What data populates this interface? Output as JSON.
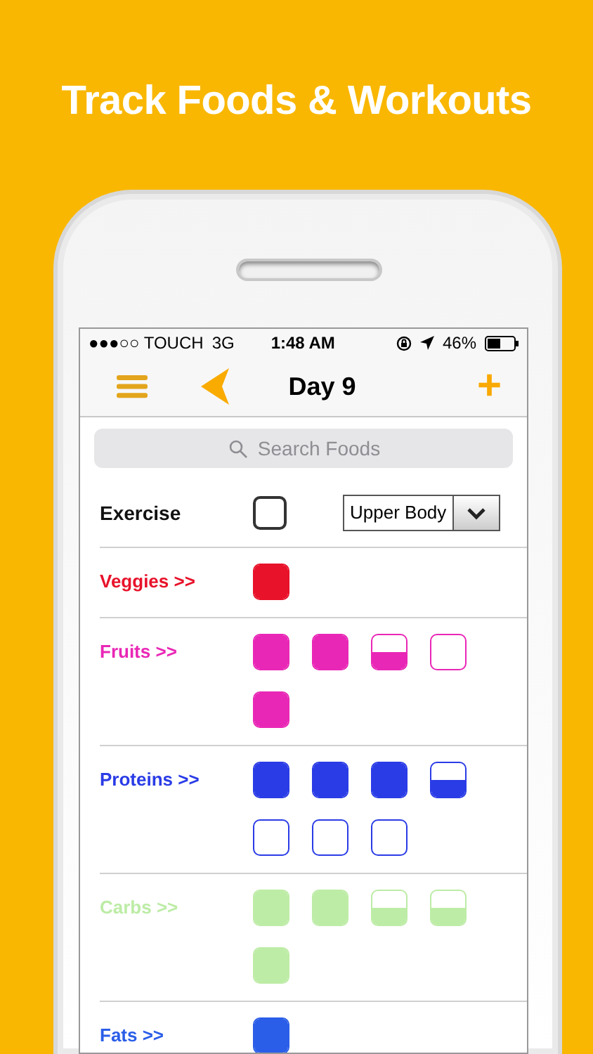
{
  "headline": "Track Foods & Workouts",
  "status_bar": {
    "carrier": "●●●○○ TOUCH",
    "network": "3G",
    "time": "1:48 AM",
    "battery": "46%"
  },
  "nav_bar": {
    "title": "Day 9",
    "add_label": "+"
  },
  "search": {
    "placeholder": "Search Foods"
  },
  "exercise": {
    "label": "Exercise",
    "checked": false,
    "workout": "Upper Body"
  },
  "categories": [
    {
      "label": "Veggies >>",
      "color": "#e8122a",
      "servings": [
        {
          "upper_filled": true,
          "lower_filled": true
        }
      ]
    },
    {
      "label": "Fruits >>",
      "color": "#e927b6",
      "servings": [
        {
          "upper_filled": true,
          "lower_filled": true
        },
        {
          "upper_filled": true,
          "lower_filled": true
        },
        {
          "upper_filled": false,
          "lower_filled": true
        },
        {
          "upper_filled": false,
          "lower_filled": false
        },
        {
          "upper_filled": true,
          "lower_filled": true
        }
      ]
    },
    {
      "label": "Proteins >>",
      "color": "#2a3ce6",
      "servings": [
        {
          "upper_filled": true,
          "lower_filled": true
        },
        {
          "upper_filled": true,
          "lower_filled": true
        },
        {
          "upper_filled": true,
          "lower_filled": true
        },
        {
          "upper_filled": false,
          "lower_filled": true
        },
        {
          "upper_filled": false,
          "lower_filled": false
        },
        {
          "upper_filled": false,
          "lower_filled": false
        },
        {
          "upper_filled": false,
          "lower_filled": false
        }
      ]
    },
    {
      "label": "Carbs >>",
      "color": "#bdeca6",
      "servings": [
        {
          "upper_filled": true,
          "lower_filled": true
        },
        {
          "upper_filled": true,
          "lower_filled": true
        },
        {
          "upper_filled": false,
          "lower_filled": true
        },
        {
          "upper_filled": false,
          "lower_filled": true
        },
        {
          "upper_filled": true,
          "lower_filled": true
        }
      ]
    },
    {
      "label": "Fats >>",
      "color": "#2b5ee8",
      "servings": [
        {
          "upper_filled": true,
          "lower_filled": true
        }
      ]
    }
  ]
}
